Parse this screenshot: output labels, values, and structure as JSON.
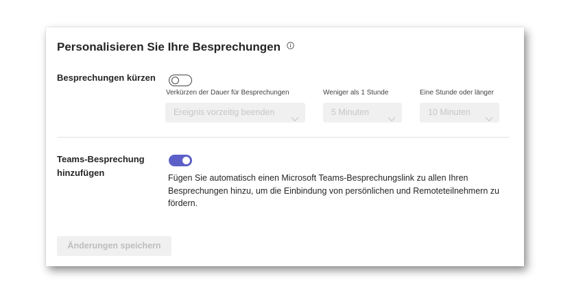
{
  "page": {
    "title": "Personalisieren Sie Ihre Besprechungen"
  },
  "shorten": {
    "label": "Besprechungen kürzen",
    "toggle_on": false,
    "duration_label": "Verkürzen der Dauer für Besprechungen",
    "duration_value": "Ereignis vorzeitig beenden",
    "under_hour_label": "Weniger als 1 Stunde",
    "under_hour_value": "5 Minuten",
    "over_hour_label": "Eine Stunde oder länger",
    "over_hour_value": "10 Minuten"
  },
  "teams": {
    "label_line1": "Teams-Besprechung",
    "label_line2": "hinzufügen",
    "toggle_on": true,
    "description": "Fügen Sie automatisch einen Microsoft Teams-Besprechungslink zu allen Ihren Besprechungen hinzu, um die Einbindung von persönlichen und Remoteteilnehmern zu fördern."
  },
  "actions": {
    "save_label": "Änderungen speichern"
  },
  "colors": {
    "accent": "#5b5fc7",
    "disabled_bg": "#f0f0f0",
    "disabled_text": "#c6c6c6"
  },
  "icons": {
    "title_icon": "info-icon",
    "dropdown_icon": "chevron-down-icon"
  }
}
